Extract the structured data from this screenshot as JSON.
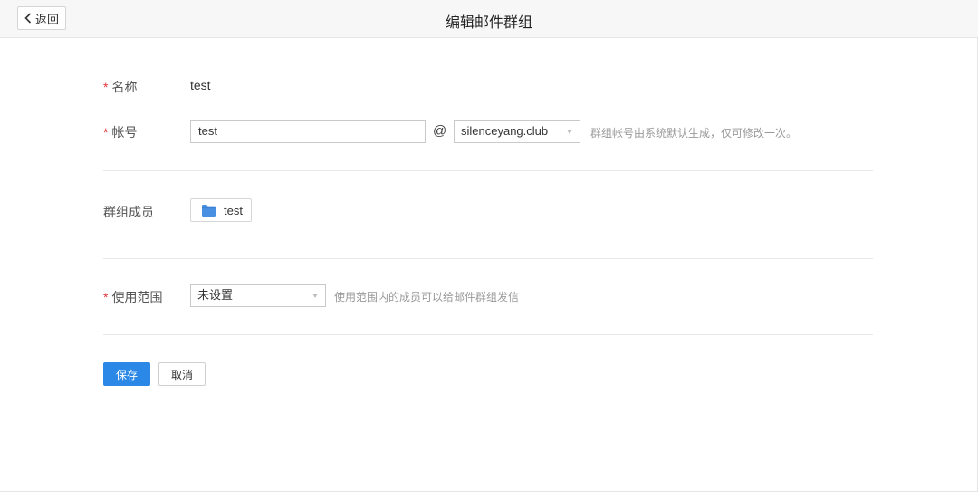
{
  "header": {
    "back_label": "返回",
    "title": "编辑邮件群组"
  },
  "form": {
    "required_mark": "*",
    "name": {
      "label": "名称",
      "value": "test"
    },
    "account": {
      "label": "帐号",
      "value": "test",
      "at_sign": "@",
      "domain": "silenceyang.club",
      "hint": "群组帐号由系统默认生成，仅可修改一次。"
    },
    "members": {
      "label": "群组成员",
      "items": [
        {
          "name": "test",
          "icon": "folder-icon"
        }
      ]
    },
    "scope": {
      "label": "使用范围",
      "selected": "未设置",
      "hint": "使用范围内的成员可以给邮件群组发信"
    }
  },
  "actions": {
    "save_label": "保存",
    "cancel_label": "取消"
  },
  "colors": {
    "primary": "#2b88e6",
    "required": "#e0393e",
    "folder": "#4a90e2"
  }
}
